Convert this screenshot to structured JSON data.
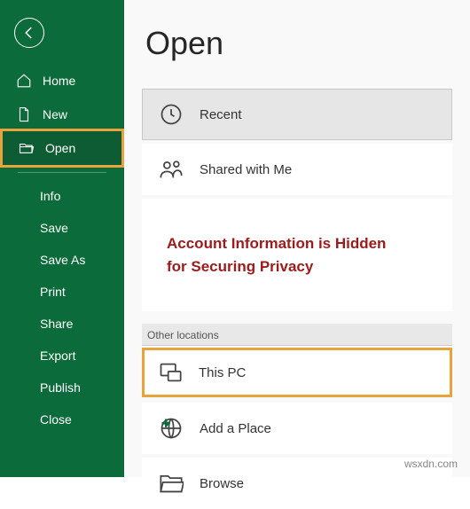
{
  "sidebar": {
    "items": [
      {
        "label": "Home"
      },
      {
        "label": "New"
      },
      {
        "label": "Open"
      },
      {
        "label": "Info"
      },
      {
        "label": "Save"
      },
      {
        "label": "Save As"
      },
      {
        "label": "Print"
      },
      {
        "label": "Share"
      },
      {
        "label": "Export"
      },
      {
        "label": "Publish"
      },
      {
        "label": "Close"
      }
    ]
  },
  "main": {
    "title": "Open",
    "recent_label": "Recent",
    "shared_label": "Shared with Me",
    "privacy_line1": "Account Information is Hidden",
    "privacy_line2": "for Securing Privacy",
    "other_locations_label": "Other locations",
    "thispc_label": "This PC",
    "addplace_label": "Add a Place",
    "browse_label": "Browse"
  },
  "watermark": "wsxdn.com"
}
